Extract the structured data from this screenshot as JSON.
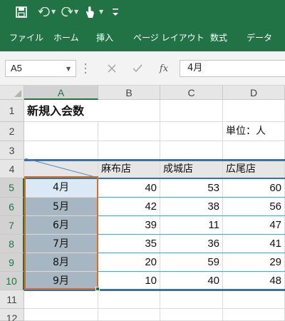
{
  "qat": {
    "icons": [
      "save-icon",
      "undo-icon",
      "redo-icon",
      "touch-mode-icon",
      "customize-qat-icon"
    ]
  },
  "ribbon": {
    "tabs": [
      "ファイル",
      "ホーム",
      "挿入",
      "ページ レイアウト",
      "数式",
      "データ"
    ]
  },
  "formula_bar": {
    "name_box": "A5",
    "fx_label": "fx",
    "formula": "4月"
  },
  "sheet": {
    "columns": [
      "A",
      "B",
      "C",
      "D"
    ],
    "rows": [
      "1",
      "2",
      "3",
      "4",
      "5",
      "6",
      "7",
      "8",
      "9",
      "10",
      "11",
      "12"
    ],
    "title": "新規入会数",
    "unit": "単位：人",
    "headers": [
      "麻布店",
      "成城店",
      "広尾店"
    ],
    "data": [
      {
        "month": "4月",
        "values": [
          "40",
          "53",
          "60"
        ]
      },
      {
        "month": "5月",
        "values": [
          "42",
          "38",
          "56"
        ]
      },
      {
        "month": "6月",
        "values": [
          "39",
          "11",
          "47"
        ]
      },
      {
        "month": "7月",
        "values": [
          "35",
          "36",
          "41"
        ]
      },
      {
        "month": "8月",
        "values": [
          "20",
          "59",
          "29"
        ]
      },
      {
        "month": "9月",
        "values": [
          "10",
          "40",
          "48"
        ]
      }
    ],
    "selection": "A5:A10",
    "active_cell": "A5"
  },
  "colors": {
    "excel_green": "#217346",
    "header_fill": "#e7e6e6",
    "selection_fill": "#a6b6c2",
    "selection_border": "#e06c23",
    "table_rule": "#2e75b6"
  }
}
